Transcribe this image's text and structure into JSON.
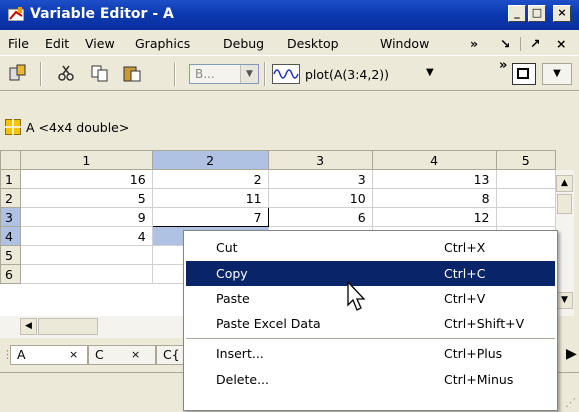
{
  "window": {
    "title": "Variable Editor - A"
  },
  "menu": [
    "File",
    "Edit",
    "View",
    "Graphics",
    "Debug",
    "Desktop",
    "Window"
  ],
  "menu_extra": {
    "overflow": "»",
    "undock": "↘",
    "restore": "↗",
    "close": "×"
  },
  "toolbar": {
    "combo_text": "B...",
    "plot_label": "plot(A(3:4,2))",
    "overflow": "»"
  },
  "variable": {
    "label": "A <4x4 double>"
  },
  "grid": {
    "columns": [
      "1",
      "2",
      "3",
      "4",
      "5"
    ],
    "rows": [
      {
        "h": "1",
        "c": [
          "16",
          "2",
          "3",
          "13",
          ""
        ]
      },
      {
        "h": "2",
        "c": [
          "5",
          "11",
          "10",
          "8",
          ""
        ]
      },
      {
        "h": "3",
        "c": [
          "9",
          "7",
          "6",
          "12",
          ""
        ]
      },
      {
        "h": "4",
        "c": [
          "4",
          "",
          "",
          "",
          ""
        ]
      },
      {
        "h": "5",
        "c": [
          "",
          "",
          "",
          "",
          ""
        ]
      },
      {
        "h": "6",
        "c": [
          "",
          "",
          "",
          "",
          ""
        ]
      }
    ]
  },
  "tabs": [
    {
      "label": "A",
      "close": "×"
    },
    {
      "label": "C",
      "close": "×"
    },
    {
      "label": "C{"
    }
  ],
  "context_menu": [
    {
      "label": "Cut",
      "shortcut": "Ctrl+X"
    },
    {
      "label": "Copy",
      "shortcut": "Ctrl+C",
      "highlighted": true
    },
    {
      "label": "Paste",
      "shortcut": "Ctrl+V"
    },
    {
      "label": "Paste Excel Data",
      "shortcut": "Ctrl+Shift+V"
    },
    {
      "label": "Insert...",
      "shortcut": "Ctrl+Plus"
    },
    {
      "label": "Delete...",
      "shortcut": "Ctrl+Minus"
    }
  ],
  "colors": {
    "titlebar": "#0b3ab0",
    "selection": "#b0c2e3",
    "menu_highlight": "#0a246a"
  }
}
